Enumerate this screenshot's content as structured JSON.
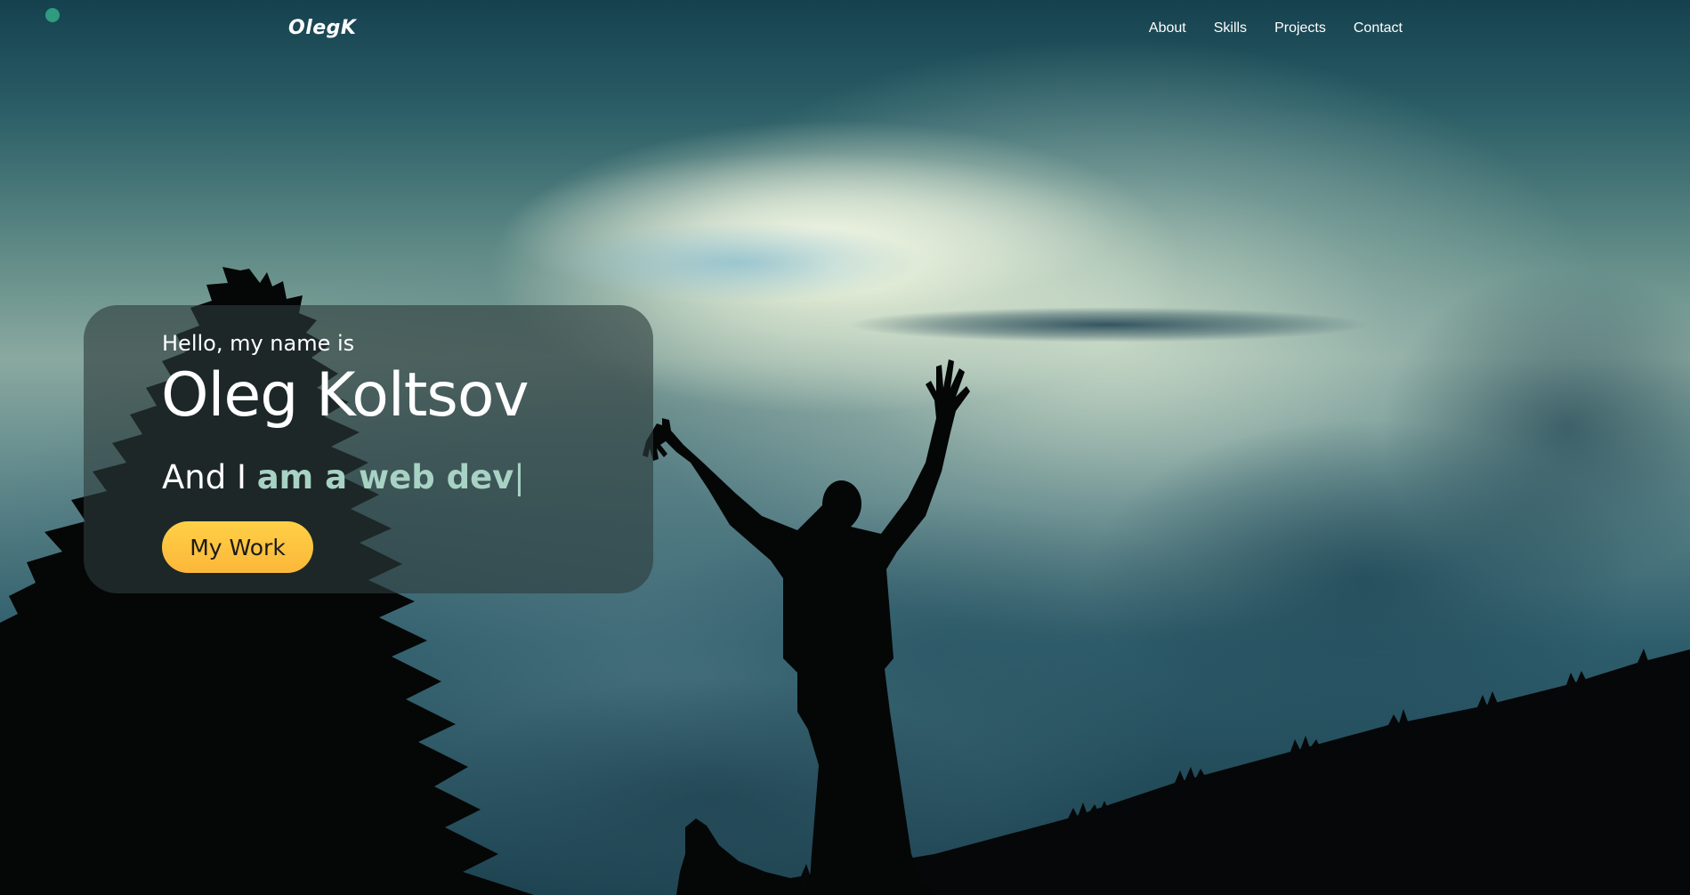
{
  "nav": {
    "logo": "OlegK",
    "links": [
      "About",
      "Skills",
      "Projects",
      "Contact"
    ]
  },
  "hero": {
    "greeting": "Hello, my name is",
    "name": "Oleg Koltsov",
    "role_prefix": "And I ",
    "role_typed": "am a web dev",
    "cursor": "|",
    "button_label": "My Work"
  },
  "colors": {
    "accent_typed": "#a7d2c4",
    "button": "#fbb73a",
    "status_dot": "#2f9b7f",
    "card_bg": "rgba(45,60,60,0.62)"
  },
  "icons": {
    "status_dot": "dot-icon"
  }
}
